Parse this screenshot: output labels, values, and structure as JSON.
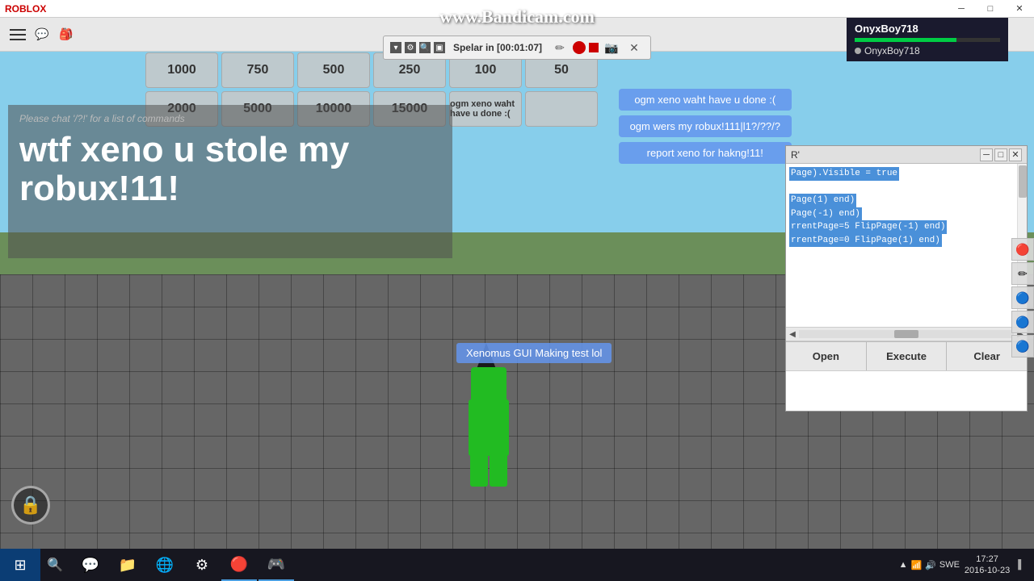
{
  "window": {
    "title": "ROBLOX",
    "close_btn": "✕",
    "minimize_btn": "─",
    "maximize_btn": "□"
  },
  "bandicam": {
    "watermark": "www.Bandicam.com"
  },
  "recording": {
    "timer_label": "Spelar in [00:01:07]"
  },
  "user": {
    "name": "OnyxBoy718",
    "online_name": "OnyxBoy718",
    "progress_pct": 70
  },
  "number_buttons": {
    "row1": [
      "1000",
      "750",
      "500",
      "250",
      "100",
      "50"
    ],
    "row2": [
      "2000",
      "5000",
      "10000",
      "15000",
      "",
      ""
    ]
  },
  "chat_bubbles": [
    "ogm xeno waht have u done :(",
    "ogm wers my robux!111|l1?/??/?",
    "report xeno for hakng!11!"
  ],
  "big_chat": {
    "hint": "Please chat '/?!' for a list of commands",
    "text": "wtf xeno u stole my robux!11!"
  },
  "char_label": "Xenomus GUI Making test lol",
  "script_editor": {
    "title": "R'",
    "code_lines": [
      "Page).Visible = true",
      "",
      "Page(1) end)",
      "Page(-1) end)",
      "rrentPage=5 FlipPage(-1) end)",
      "rrentPage=0 FlipPage(1) end)"
    ],
    "buttons": {
      "open": "Open",
      "execute": "Execute",
      "clear": "Clear"
    }
  },
  "taskbar": {
    "start_icon": "⊞",
    "search_icon": "🔍",
    "time": "17:27",
    "date": "2016-10-23",
    "language": "SWE",
    "apps": [
      "💬",
      "📁",
      "🌐",
      "⚙",
      "🔴",
      "🎮"
    ]
  },
  "lock_icon": "🔒"
}
